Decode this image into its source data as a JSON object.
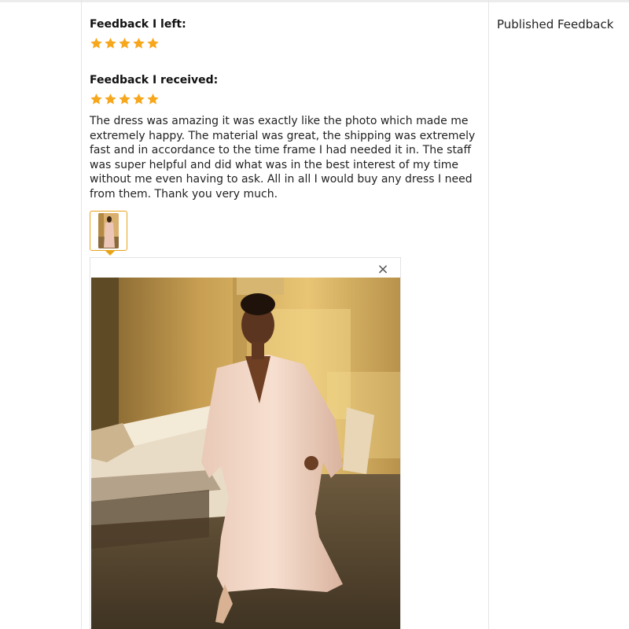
{
  "feedback_left": {
    "heading": "Feedback I left:",
    "rating": 5
  },
  "feedback_received": {
    "heading": "Feedback I received:",
    "rating": 5,
    "text": "The dress was amazing it was exactly like the photo which made me extremely happy. The material was great, the shipping was extremely fast and in accordance to the time frame I had needed it in. The staff was super helpful and did what was in the best interest of my time without me even having to ask. All in all I would buy any dress I need from them. Thank you very much."
  },
  "image_viewer": {
    "close_icon": "×"
  },
  "sidebar": {
    "label": "Published Feedback"
  },
  "colors": {
    "star": "#f7a71c",
    "thumb_border": "#e8a317"
  },
  "icons": [
    "star-icon",
    "close-icon"
  ]
}
